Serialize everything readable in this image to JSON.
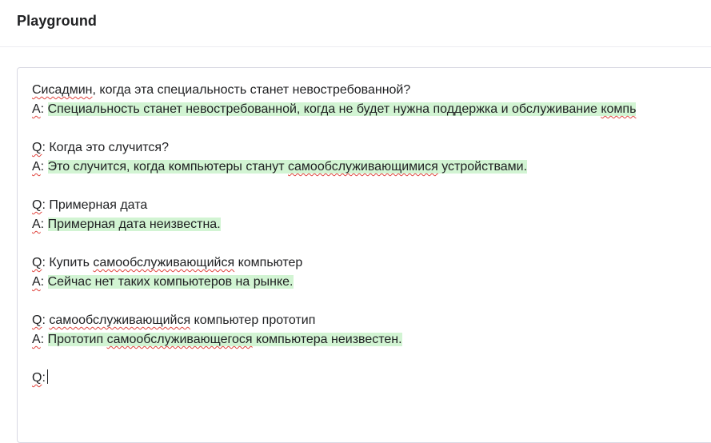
{
  "app": {
    "title": "Playground"
  },
  "editor": {
    "prompt_line": {
      "w1": "Сисадмин",
      "rest": ", когда эта специальность станет невостребованной?"
    },
    "blocks": [
      {
        "answer_prefix": "A",
        "answer_colon": ": ",
        "answer_parts": [
          "Специальность станет невостребованной, когда не будет нужна поддержка и обслуживание ",
          "компь"
        ]
      },
      {
        "question_prefix": "Q",
        "question_text": ": Когда это случится?",
        "answer_prefix": "A",
        "answer_colon": ": ",
        "answer_parts": [
          "Это случится, когда компьютеры станут ",
          "самообслуживающимися",
          " устройствами."
        ]
      },
      {
        "question_prefix": "Q",
        "question_text": ": Примерная дата",
        "answer_prefix": "A",
        "answer_colon": ": ",
        "answer_parts": [
          "Примерная дата неизвестна."
        ]
      },
      {
        "question_prefix": "Q",
        "question_parts": [
          ": Купить ",
          "самообслуживающийся",
          " компьютер"
        ],
        "answer_prefix": "A",
        "answer_colon": ": ",
        "answer_parts": [
          "Сейчас нет таких компьютеров на рынке."
        ]
      },
      {
        "question_prefix": "Q",
        "question_parts": [
          ": ",
          "самообслуживающийся",
          " компьютер прототип"
        ],
        "answer_prefix": "A",
        "answer_colon": ": ",
        "answer_parts": [
          "Прототип ",
          "самообслуживающегося",
          " компьютера неизвестен."
        ]
      }
    ],
    "final_line": {
      "prefix": "Q",
      "text": ":"
    }
  },
  "colors": {
    "completion_highlight": "#d2f4d3",
    "spellcheck_underline": "#e0443e",
    "border": "#d9d9e3"
  }
}
